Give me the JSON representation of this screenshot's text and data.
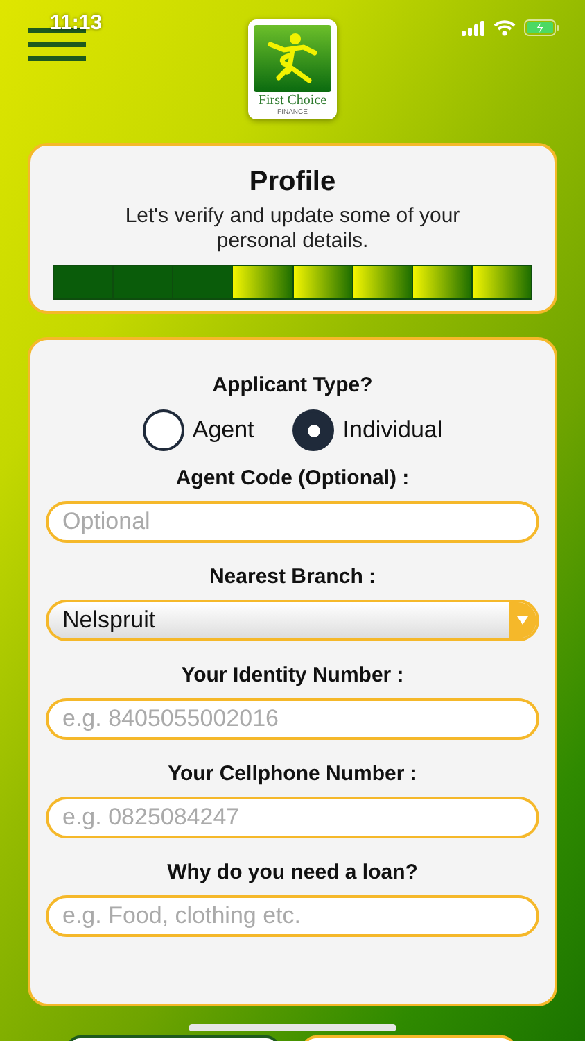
{
  "status_bar": {
    "time": "11:13"
  },
  "logo": {
    "name": "First Choice",
    "subtitle": "FINANCE"
  },
  "profile": {
    "title": "Profile",
    "description": "Let's verify and update some of your personal details.",
    "steps": [
      {
        "done": true
      },
      {
        "done": true
      },
      {
        "done": true
      },
      {
        "done": false
      },
      {
        "done": false
      },
      {
        "done": false
      },
      {
        "done": false
      },
      {
        "done": false
      }
    ]
  },
  "form": {
    "applicant_type": {
      "label": "Applicant Type?",
      "options": [
        {
          "label": "Agent",
          "selected": false
        },
        {
          "label": "Individual",
          "selected": true
        }
      ]
    },
    "fields": [
      {
        "kind": "text",
        "label": "Agent Code (Optional) :",
        "placeholder": "Optional"
      },
      {
        "kind": "select",
        "label": "Nearest Branch :",
        "value": "Nelspruit"
      },
      {
        "kind": "text",
        "label": "Your Identity Number :",
        "placeholder": "e.g. 8405055002016"
      },
      {
        "kind": "text",
        "label": "Your Cellphone Number :",
        "placeholder": "e.g. 0825084247"
      },
      {
        "kind": "text",
        "label": "Why do you need a loan?",
        "placeholder": "e.g. Food, clothing etc."
      }
    ]
  }
}
